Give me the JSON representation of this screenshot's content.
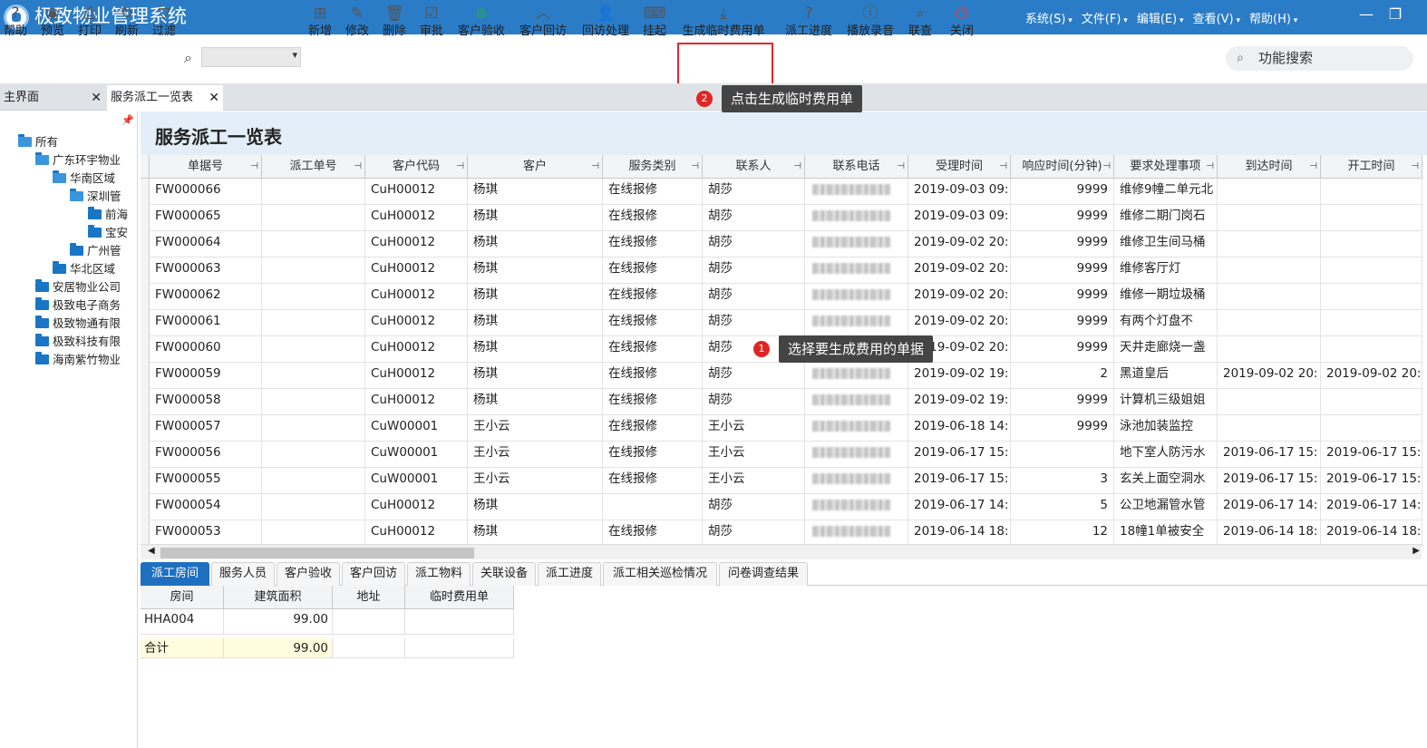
{
  "app": {
    "title": "极致物业管理系统"
  },
  "menu": [
    {
      "label": "系统(S)"
    },
    {
      "label": "文件(F)"
    },
    {
      "label": "编辑(E)"
    },
    {
      "label": "查看(V)"
    },
    {
      "label": "帮助(H)"
    }
  ],
  "toolbar": {
    "buttons": [
      {
        "label": "帮助",
        "icon": "help-icon"
      },
      {
        "label": "预览",
        "icon": "eye-icon"
      },
      {
        "label": "打印",
        "icon": "printer-icon"
      },
      {
        "label": "刷新",
        "icon": "refresh-icon"
      },
      {
        "label": "过滤",
        "icon": "filter-icon"
      },
      {
        "label": "新增",
        "icon": "add-icon"
      },
      {
        "label": "修改",
        "icon": "edit-icon"
      },
      {
        "label": "删除",
        "icon": "trash-icon"
      },
      {
        "label": "审批",
        "icon": "approve-icon"
      },
      {
        "label": "客户验收",
        "icon": "plus-circle-icon"
      },
      {
        "label": "客户回访",
        "icon": "chevron-up-icon"
      },
      {
        "label": "回访处理",
        "icon": "user-icon"
      },
      {
        "label": "挂起",
        "icon": "keyboard-icon"
      },
      {
        "label": "生成临时费用单",
        "icon": "download-icon"
      },
      {
        "label": "派工进度",
        "icon": "question-icon"
      },
      {
        "label": "播放录音",
        "icon": "alert-icon"
      },
      {
        "label": "联查",
        "icon": "search-icon"
      },
      {
        "label": "关闭",
        "icon": "power-icon"
      }
    ],
    "function_search": "功能搜索"
  },
  "tabs": [
    {
      "label": "主界面"
    },
    {
      "label": "服务派工一览表"
    }
  ],
  "tips": {
    "step1": {
      "num": "1",
      "text": "选择要生成费用的单据"
    },
    "step2": {
      "num": "2",
      "text": "点击生成临时费用单"
    }
  },
  "tree": [
    {
      "label": "所有"
    },
    {
      "label": "广东环宇物业"
    },
    {
      "label": "华南区域"
    },
    {
      "label": "深圳管"
    },
    {
      "label": "前海"
    },
    {
      "label": "宝安"
    },
    {
      "label": "广州管"
    },
    {
      "label": "华北区域"
    },
    {
      "label": "安居物业公司"
    },
    {
      "label": "极致电子商务"
    },
    {
      "label": "极致物通有限"
    },
    {
      "label": "极致科技有限"
    },
    {
      "label": "海南紫竹物业"
    }
  ],
  "list": {
    "title": "服务派工一览表",
    "columns": [
      "单据号",
      "派工单号",
      "客户代码",
      "客户",
      "服务类别",
      "联系人",
      "联系电话",
      "受理时间",
      "响应时间(分钟)",
      "要求处理事项",
      "到达时间",
      "开工时间"
    ],
    "rows": [
      [
        "FW000066",
        "",
        "CuH00012",
        "杨琪",
        "在线报修",
        "胡莎",
        "",
        "2019-09-03 09:",
        "9999",
        "维修9幢二单元北",
        "",
        ""
      ],
      [
        "FW000065",
        "",
        "CuH00012",
        "杨琪",
        "在线报修",
        "胡莎",
        "",
        "2019-09-03 09:",
        "9999",
        "维修二期门岗石",
        "",
        ""
      ],
      [
        "FW000064",
        "",
        "CuH00012",
        "杨琪",
        "在线报修",
        "胡莎",
        "",
        "2019-09-02 20:",
        "9999",
        "维修卫生间马桶",
        "",
        ""
      ],
      [
        "FW000063",
        "",
        "CuH00012",
        "杨琪",
        "在线报修",
        "胡莎",
        "",
        "2019-09-02 20:",
        "9999",
        "维修客厅灯",
        "",
        ""
      ],
      [
        "FW000062",
        "",
        "CuH00012",
        "杨琪",
        "在线报修",
        "胡莎",
        "",
        "2019-09-02 20:",
        "9999",
        "维修一期垃圾桶",
        "",
        ""
      ],
      [
        "FW000061",
        "",
        "CuH00012",
        "杨琪",
        "在线报修",
        "胡莎",
        "",
        "2019-09-02 20:",
        "9999",
        "有两个灯盘不",
        "",
        ""
      ],
      [
        "FW000060",
        "",
        "CuH00012",
        "杨琪",
        "在线报修",
        "胡莎",
        "",
        "2019-09-02 20:",
        "9999",
        "天井走廊烧一盏",
        "",
        ""
      ],
      [
        "FW000059",
        "",
        "CuH00012",
        "杨琪",
        "在线报修",
        "胡莎",
        "",
        "2019-09-02 19:",
        "2",
        "黑道皇后",
        "2019-09-02 20:",
        "2019-09-02 20:"
      ],
      [
        "FW000058",
        "",
        "CuH00012",
        "杨琪",
        "在线报修",
        "胡莎",
        "",
        "2019-09-02 19:",
        "9999",
        "计算机三级姐姐",
        "",
        ""
      ],
      [
        "FW000057",
        "",
        "CuW00001",
        "王小云",
        "在线报修",
        "王小云",
        "",
        "2019-06-18 14:",
        "9999",
        "泳池加装监控",
        "",
        ""
      ],
      [
        "FW000056",
        "",
        "CuW00001",
        "王小云",
        "在线报修",
        "王小云",
        "",
        "2019-06-17 15:",
        "",
        "地下室人防污水",
        "2019-06-17 15:",
        "2019-06-17 15:"
      ],
      [
        "FW000055",
        "",
        "CuW00001",
        "王小云",
        "在线报修",
        "王小云",
        "",
        "2019-06-17 15:",
        "3",
        "玄关上面空洞水",
        "2019-06-17 15:",
        "2019-06-17 15:"
      ],
      [
        "FW000054",
        "",
        "CuH00012",
        "杨琪",
        "",
        "胡莎",
        "",
        "2019-06-17 14:",
        "5",
        "公卫地漏管水管",
        "2019-06-17 14:",
        "2019-06-17 14:"
      ],
      [
        "FW000053",
        "",
        "CuH00012",
        "杨琪",
        "在线报修",
        "胡莎",
        "",
        "2019-06-14 18:",
        "12",
        "18幢1单被安全",
        "2019-06-14 18:",
        "2019-06-14 18:"
      ]
    ]
  },
  "subtabs": [
    {
      "label": "派工房间"
    },
    {
      "label": "服务人员"
    },
    {
      "label": "客户验收"
    },
    {
      "label": "客户回访"
    },
    {
      "label": "派工物料"
    },
    {
      "label": "关联设备"
    },
    {
      "label": "派工进度"
    },
    {
      "label": "派工相关巡检情况"
    },
    {
      "label": "问卷调查结果"
    }
  ],
  "room_grid": {
    "columns": [
      "房间",
      "建筑面积",
      "地址",
      "临时费用单"
    ],
    "rows": [
      [
        "HHA004",
        "99.00",
        "",
        ""
      ]
    ],
    "total_label": "合计",
    "total_area": "99.00"
  },
  "colors": {
    "titlebar": "#2a7cc7",
    "highlight": "#e6262a",
    "active_subtab": "#1e6fc0"
  }
}
